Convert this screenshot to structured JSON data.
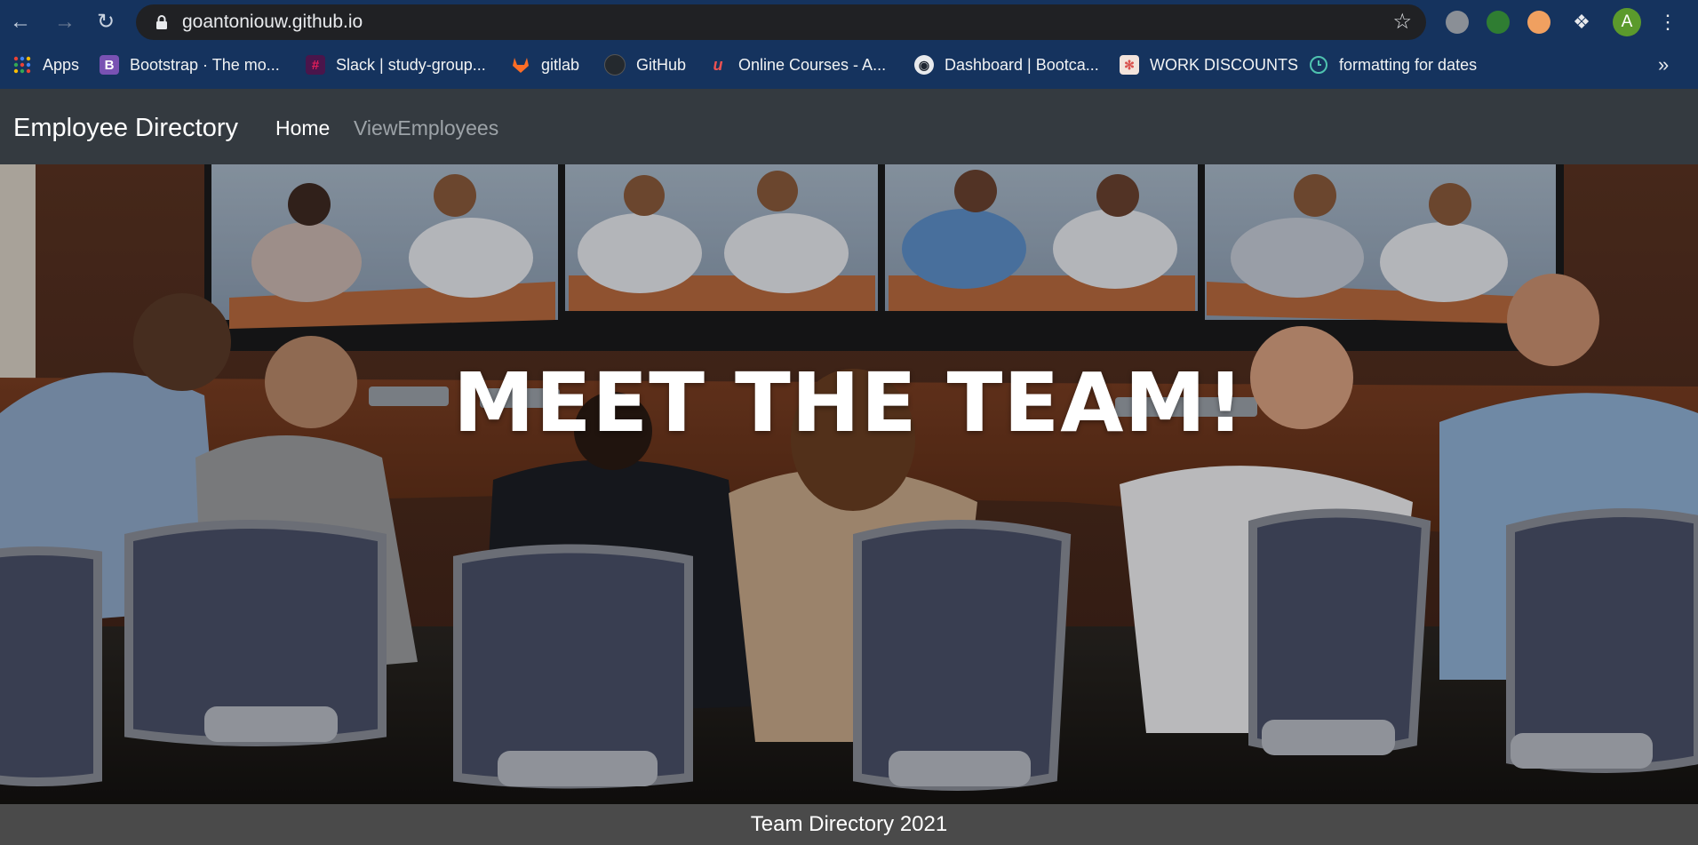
{
  "browser": {
    "url": "goantoniouw.github.io",
    "avatar_letter": "A",
    "bookmarks": [
      {
        "label": "Apps",
        "icon": "apps-grid-icon",
        "color": "#e8eaed"
      },
      {
        "label": "Bootstrap · The mo...",
        "icon": "bootstrap-icon",
        "color": "#7952b3"
      },
      {
        "label": "Slack | study-group...",
        "icon": "slack-icon",
        "color": "#e01e5a"
      },
      {
        "label": "gitlab",
        "icon": "gitlab-icon",
        "color": "#fc6d26"
      },
      {
        "label": "GitHub",
        "icon": "github-icon",
        "color": "#24292e"
      },
      {
        "label": "Online Courses - A...",
        "icon": "udemy-icon",
        "color": "#ec5252"
      },
      {
        "label": "Dashboard | Bootca...",
        "icon": "globe-icon",
        "color": "#e8eaed"
      },
      {
        "label": "WORK DISCOUNTS",
        "icon": "discount-icon",
        "color": "#f3e4dc"
      },
      {
        "label": "formatting for dates",
        "icon": "clock-icon",
        "color": "#4fc3b0"
      }
    ],
    "bookmarks_overflow": "»"
  },
  "navbar": {
    "brand": "Employee Directory",
    "links": [
      {
        "label": "Home",
        "active": true
      },
      {
        "label": "ViewEmployees",
        "active": false
      }
    ]
  },
  "hero": {
    "title": "MEET THE TEAM!"
  },
  "footer": {
    "text": "Team Directory 2021"
  }
}
